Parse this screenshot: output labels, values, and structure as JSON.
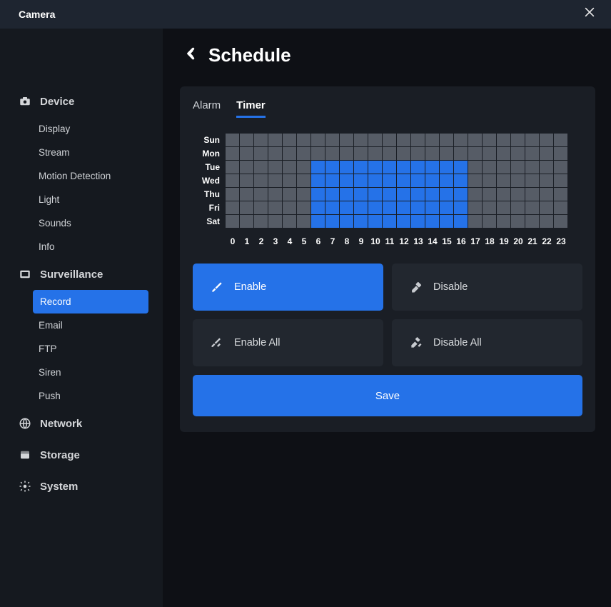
{
  "header": {
    "title": "Camera"
  },
  "sidebar": {
    "groups": [
      {
        "key": "device",
        "label": "Device",
        "items": [
          {
            "label": "Display"
          },
          {
            "label": "Stream"
          },
          {
            "label": "Motion Detection"
          },
          {
            "label": "Light"
          },
          {
            "label": "Sounds"
          },
          {
            "label": "Info"
          }
        ]
      },
      {
        "key": "surveillance",
        "label": "Surveillance",
        "items": [
          {
            "label": "Record",
            "active": true
          },
          {
            "label": "Email"
          },
          {
            "label": "FTP"
          },
          {
            "label": "Siren"
          },
          {
            "label": "Push"
          }
        ]
      },
      {
        "key": "network",
        "label": "Network",
        "items": []
      },
      {
        "key": "storage",
        "label": "Storage",
        "items": []
      },
      {
        "key": "system",
        "label": "System",
        "items": []
      }
    ]
  },
  "page": {
    "title": "Schedule"
  },
  "tabs": [
    {
      "label": "Alarm",
      "active": false
    },
    {
      "label": "Timer",
      "active": true
    }
  ],
  "schedule": {
    "days": [
      "Sun",
      "Mon",
      "Tue",
      "Wed",
      "Thu",
      "Fri",
      "Sat"
    ],
    "hours": [
      "0",
      "1",
      "2",
      "3",
      "4",
      "5",
      "6",
      "7",
      "8",
      "9",
      "10",
      "11",
      "12",
      "13",
      "14",
      "15",
      "16",
      "17",
      "18",
      "19",
      "20",
      "21",
      "22",
      "23"
    ],
    "enabled": {
      "Sun": [],
      "Mon": [],
      "Tue": [
        6,
        7,
        8,
        9,
        10,
        11,
        12,
        13,
        14,
        15,
        16
      ],
      "Wed": [
        6,
        7,
        8,
        9,
        10,
        11,
        12,
        13,
        14,
        15,
        16
      ],
      "Thu": [
        6,
        7,
        8,
        9,
        10,
        11,
        12,
        13,
        14,
        15,
        16
      ],
      "Fri": [
        6,
        7,
        8,
        9,
        10,
        11,
        12,
        13,
        14,
        15,
        16
      ],
      "Sat": [
        6,
        7,
        8,
        9,
        10,
        11,
        12,
        13,
        14,
        15,
        16
      ]
    }
  },
  "buttons": {
    "enable": "Enable",
    "disable": "Disable",
    "enable_all": "Enable All",
    "disable_all": "Disable All",
    "save": "Save"
  }
}
